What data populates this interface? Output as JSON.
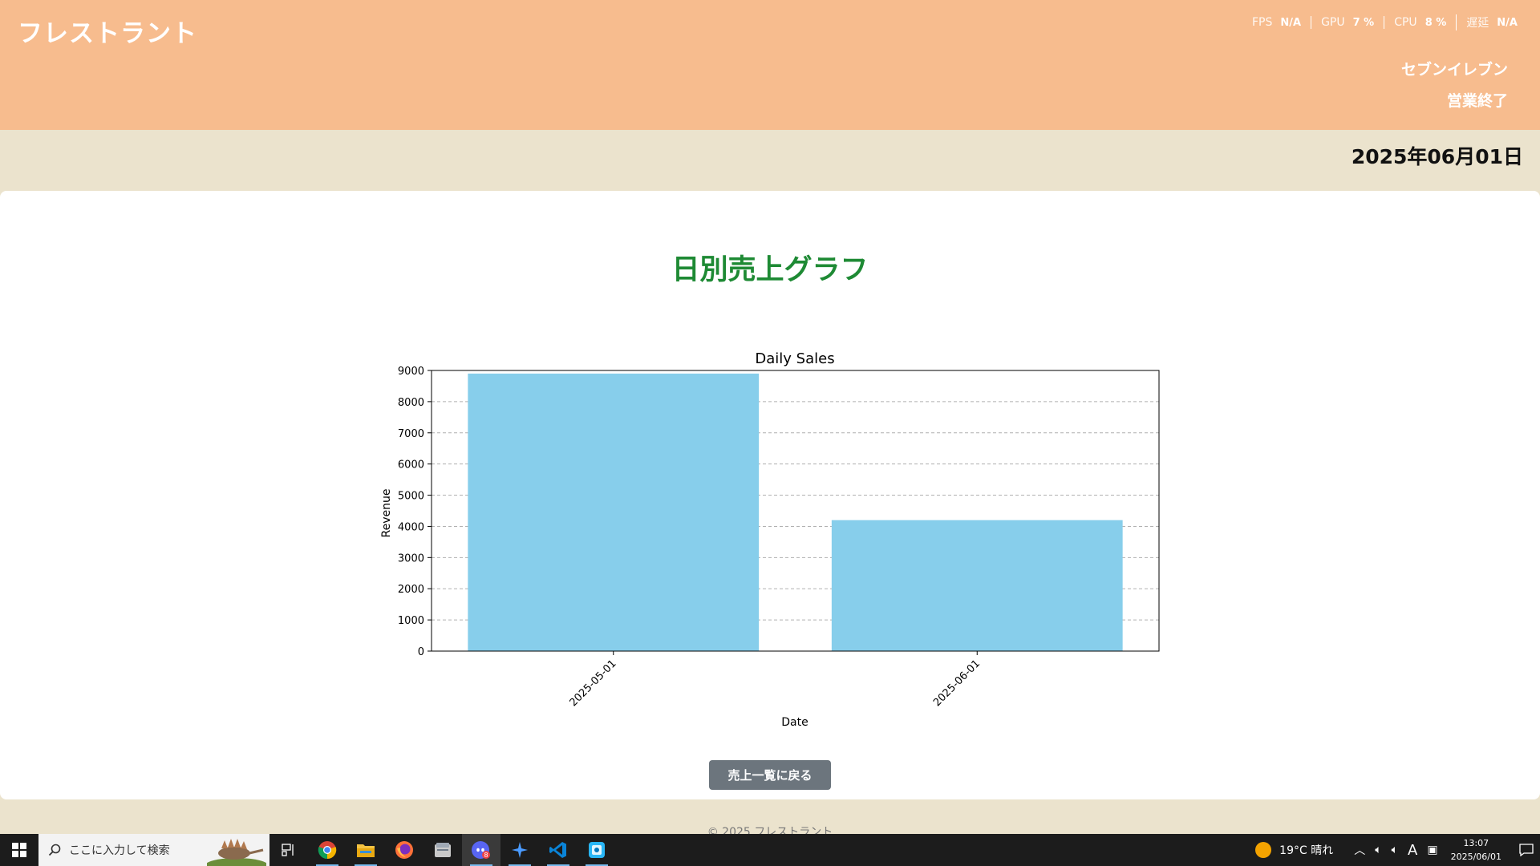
{
  "app": {
    "brand": "フレストラント",
    "perf": [
      {
        "label": "FPS",
        "value": "N/A"
      },
      {
        "label": "GPU",
        "value": "7 %"
      },
      {
        "label": "CPU",
        "value": "8 %"
      },
      {
        "label": "遅延",
        "value": "N/A"
      }
    ],
    "store_name": "セブンイレブン",
    "store_status": "営業終了",
    "date": "2025年06月01日"
  },
  "main": {
    "title": "日別売上グラフ",
    "back_button": "売上一覧に戻る",
    "footer": "© 2025 フレストラント"
  },
  "chart_data": {
    "type": "bar",
    "title": "Daily Sales",
    "xlabel": "Date",
    "ylabel": "Revenue",
    "categories": [
      "2025-05-01",
      "2025-06-01"
    ],
    "values": [
      8900,
      4200
    ],
    "ylim": [
      0,
      9000
    ],
    "yticks": [
      0,
      1000,
      2000,
      3000,
      4000,
      5000,
      6000,
      7000,
      8000,
      9000
    ],
    "grid": true,
    "bar_color": "#87ceeb"
  },
  "taskbar": {
    "search_placeholder": "ここに入力して検索",
    "apps": [
      "chrome-icon",
      "file-explorer-icon",
      "firefox-icon",
      "files-icon",
      "discord-icon",
      "copilot-icon",
      "vscode-icon",
      "app-icon"
    ],
    "discord_badge": "8",
    "weather": "19°C  晴れ",
    "time": "13:07",
    "date": "2025/06/01",
    "ime": "A"
  },
  "colors": {
    "header": "#f7bc8e",
    "background": "#ebe3cd",
    "title_green": "#1e8a34",
    "button_gray": "#6c757d"
  }
}
